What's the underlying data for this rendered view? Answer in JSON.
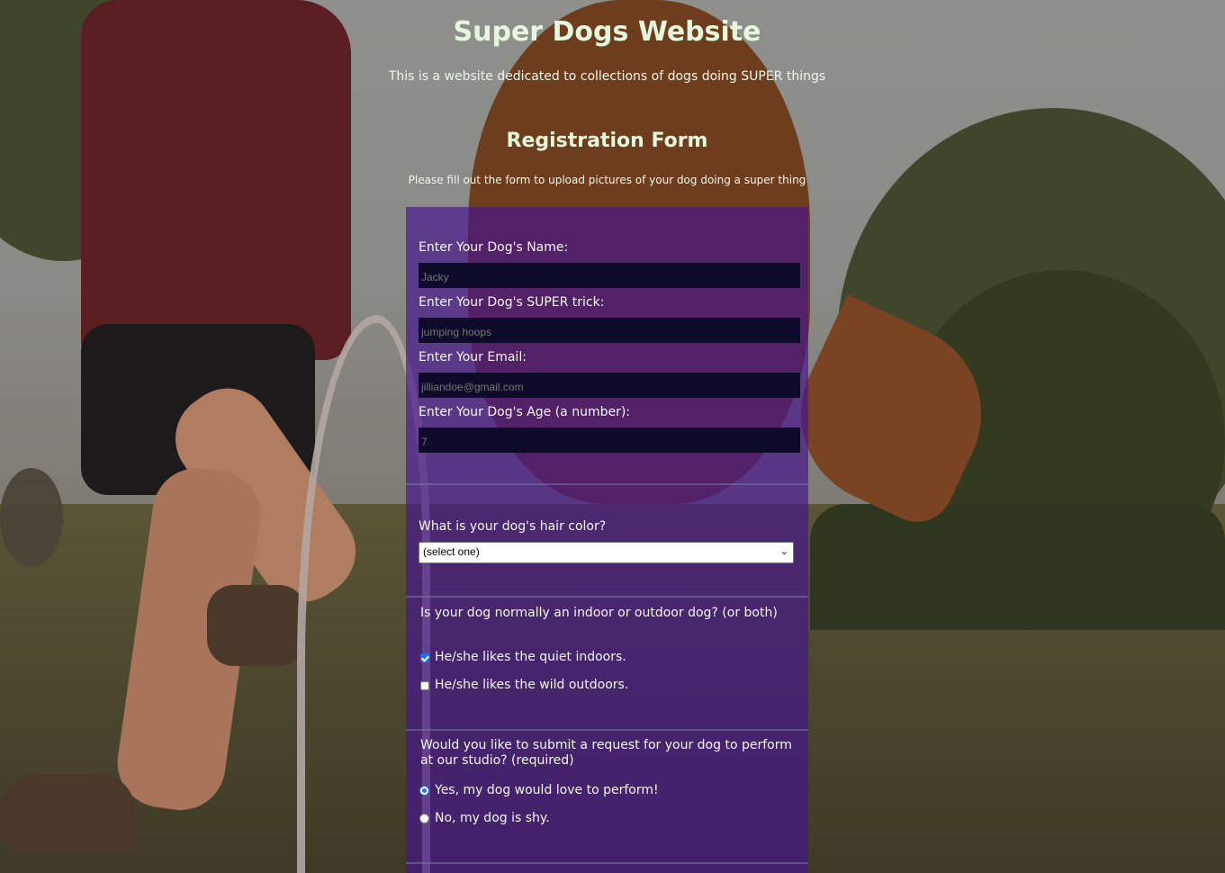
{
  "header": {
    "title": "Super Dogs Website",
    "subtitle": "This is a website dedicated to collections of dogs doing SUPER things"
  },
  "form": {
    "title": "Registration Form",
    "description": "Please fill out the form to upload pictures of your dog doing a super thing",
    "fields": [
      {
        "label": "Enter Your Dog's Name:",
        "placeholder": "Jacky"
      },
      {
        "label": "Enter Your Dog's SUPER trick:",
        "placeholder": "jumping hoops"
      },
      {
        "label": "Enter Your Email:",
        "placeholder": "jilliandoe@gmail.com"
      },
      {
        "label": "Enter Your Dog's Age (a number):",
        "placeholder": "7"
      }
    ],
    "hair_color": {
      "label": "What is your dog's hair color?",
      "selected": "(select one)"
    },
    "indoor_outdoor": {
      "question": "Is your dog normally an indoor or outdoor dog? (or both)",
      "options": [
        {
          "label": "He/she likes the quiet indoors.",
          "checked": true
        },
        {
          "label": "He/she likes the wild outdoors.",
          "checked": false
        }
      ]
    },
    "perform": {
      "question": "Would you like to submit a request for your dog to perform at our studio? (required)",
      "options": [
        {
          "label": "Yes, my dog would love to perform!",
          "checked": true
        },
        {
          "label": "No, my dog is shy.",
          "checked": false
        }
      ]
    }
  },
  "colors": {
    "heading": "#e5f7dc",
    "panel": "#46148c",
    "input_bg": "#0d0a2a",
    "accent": "#1a73e8"
  }
}
